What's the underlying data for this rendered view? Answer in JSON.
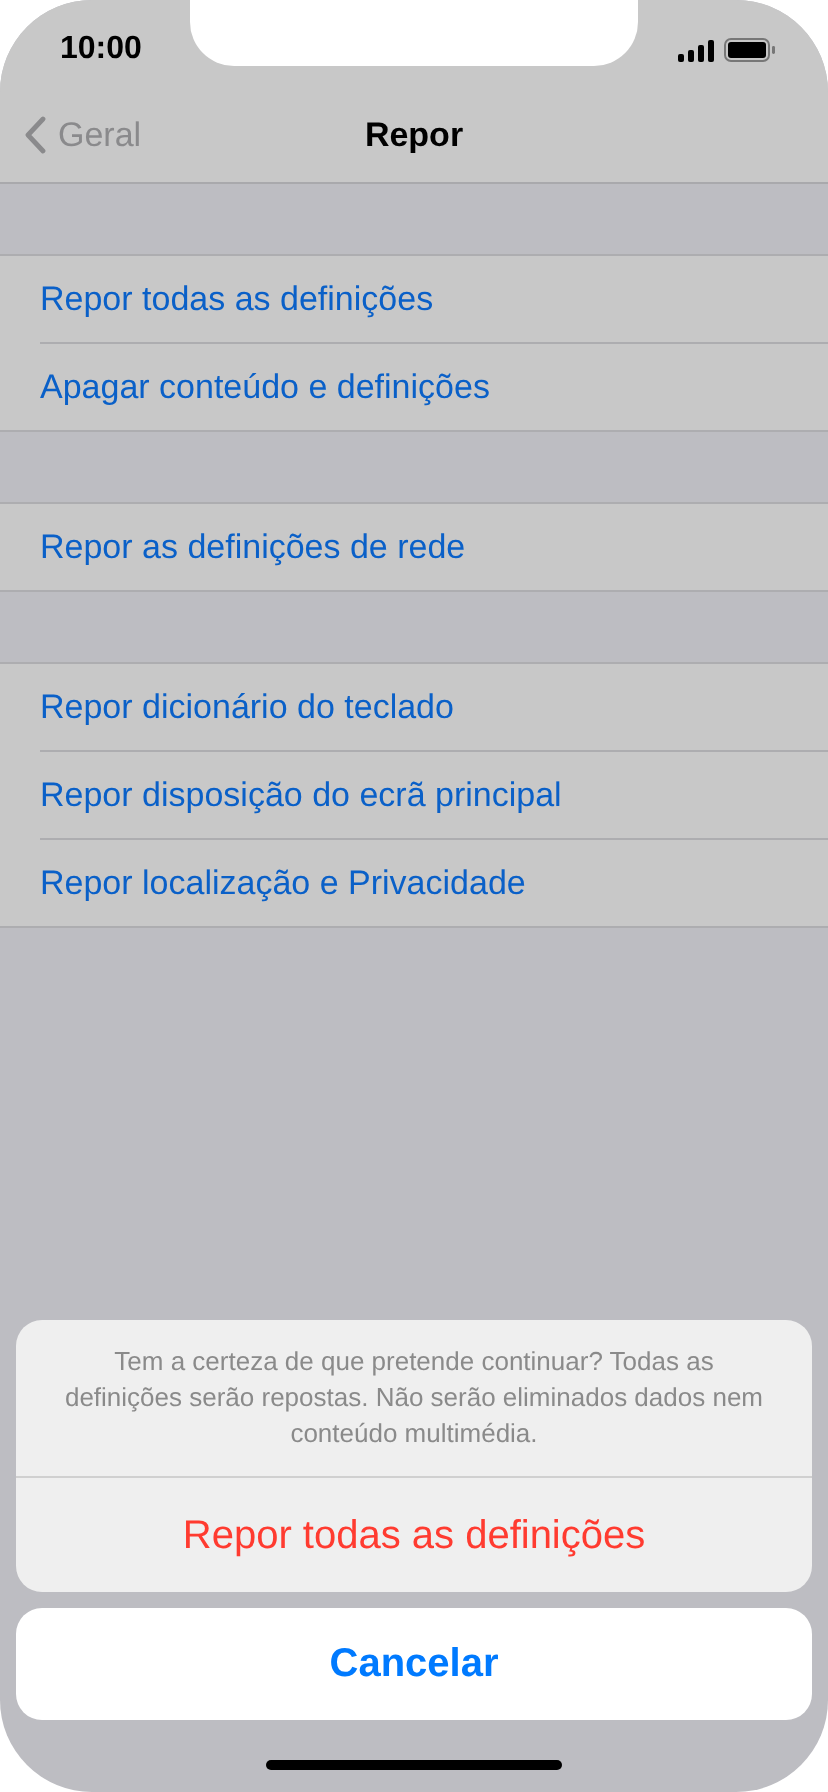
{
  "status_bar": {
    "time": "10:00"
  },
  "nav": {
    "back": "Geral",
    "title": "Repor"
  },
  "groups": [
    {
      "items": [
        "Repor todas as definições",
        "Apagar conteúdo e definições"
      ]
    },
    {
      "items": [
        "Repor as definições de rede"
      ]
    },
    {
      "items": [
        "Repor dicionário do teclado",
        "Repor disposição do ecrã principal",
        "Repor localização e Privacidade"
      ]
    }
  ],
  "action_sheet": {
    "message": "Tem a certeza de que pretende continuar? Todas as definições serão repostas. Não serão eliminados dados nem conteúdo multimédia.",
    "actions": [
      {
        "label": "Repor todas as definições",
        "kind": "destructive"
      }
    ],
    "cancel": "Cancelar"
  }
}
